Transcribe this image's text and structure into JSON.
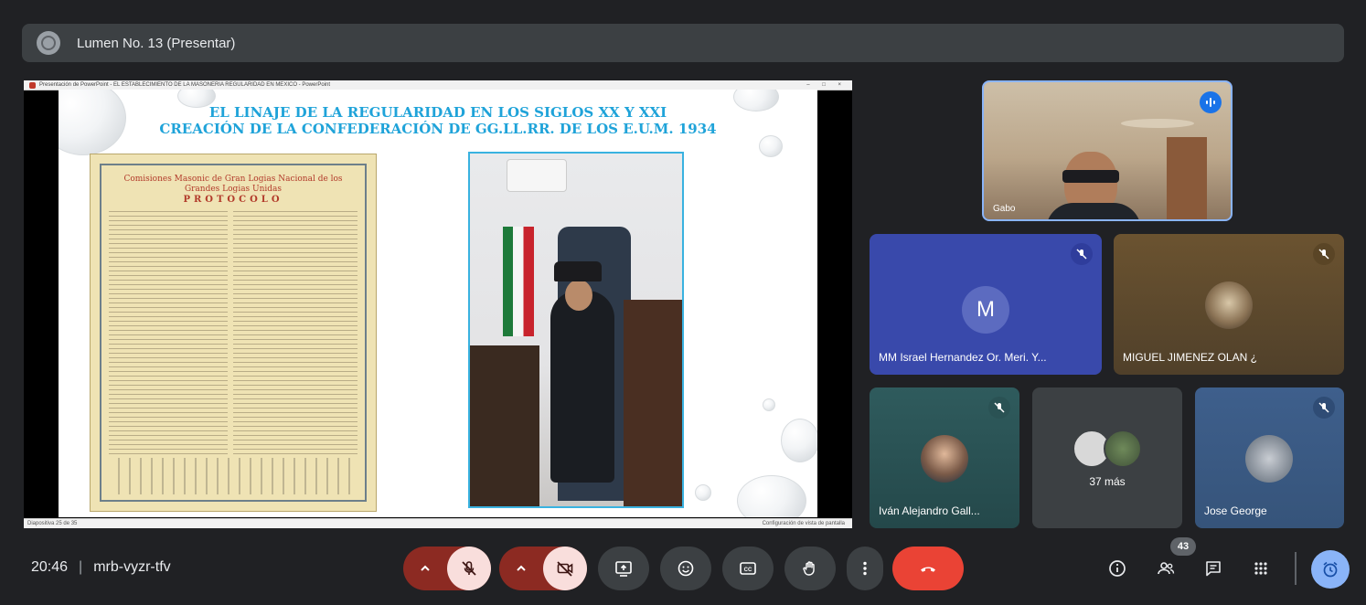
{
  "presentation_bar": {
    "title": "Lumen No. 13 (Presentar)"
  },
  "shared_screen": {
    "window_title": "Presentación de PowerPoint - EL ESTABLECIMIENTO DE LA MASONERIA REGULARIDAD EN MEXICO - PowerPoint",
    "window_controls": "– □ ×",
    "slide": {
      "title_line1": "EL LINAJE DE LA REGULARIDAD EN LOS SIGLOS XX  Y XXI",
      "title_line2": "CREACIÓN DE LA CONFEDERACIÓN DE GG.LL.RR. DE LOS E.U.M. 1934",
      "document_heading": "Comisiones Masonic de Gran Logias Nacional de los Grandes Logias Unidas",
      "document_subheading": "PROTOCOLO"
    },
    "status_left": "Diapositiva 25 de 35",
    "status_right": "Configuración de vista de pantalla"
  },
  "participants": [
    {
      "name": "Gabo",
      "speaking": true
    },
    {
      "name": "MM Israel Hernandez Or. Meri. Y...",
      "initial": "M",
      "muted": true,
      "color": "#3949ab"
    },
    {
      "name": "MIGUEL JIMENEZ OLAN ¿",
      "muted": true
    },
    {
      "name": "Iván Alejandro Gall...",
      "muted": true
    },
    {
      "overflow_label": "37 más"
    },
    {
      "name": "Jose George",
      "muted": true
    }
  ],
  "toolbar": {
    "time": "20:46",
    "meeting_code": "mrb-vyzr-tfv",
    "participant_count": "43",
    "colors": {
      "danger": "#ea4335",
      "muted_bg": "#f9dedc",
      "accent_blue": "#8ab4f8"
    }
  }
}
